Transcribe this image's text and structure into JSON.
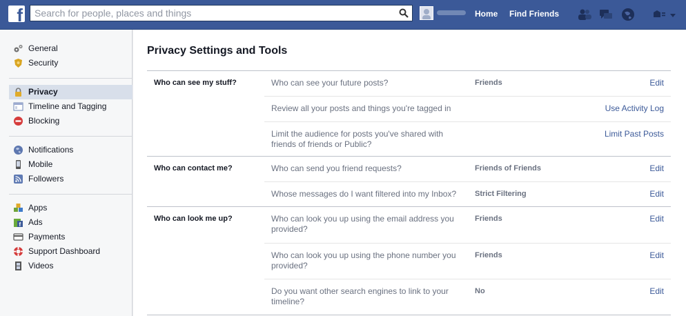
{
  "topbar": {
    "search_placeholder": "Search for people, places and things",
    "nav_home": "Home",
    "nav_find_friends": "Find Friends",
    "icons": [
      "friend-requests-icon",
      "messages-icon",
      "notifications-globe-icon",
      "privacy-shortcuts-icon"
    ]
  },
  "colors": {
    "brand": "#3b5998",
    "link": "#3b5998",
    "sidebar_active": "#d8dfea"
  },
  "sidebar": {
    "groups": [
      [
        {
          "label": "General",
          "icon": "gears-icon"
        },
        {
          "label": "Security",
          "icon": "shield-badge-icon"
        }
      ],
      [
        {
          "label": "Privacy",
          "icon": "lock-icon",
          "active": true
        },
        {
          "label": "Timeline and Tagging",
          "icon": "timeline-icon"
        },
        {
          "label": "Blocking",
          "icon": "blocking-icon"
        }
      ],
      [
        {
          "label": "Notifications",
          "icon": "globe-icon"
        },
        {
          "label": "Mobile",
          "icon": "mobile-phone-icon"
        },
        {
          "label": "Followers",
          "icon": "rss-icon"
        }
      ],
      [
        {
          "label": "Apps",
          "icon": "apps-cubes-icon"
        },
        {
          "label": "Ads",
          "icon": "ads-icon"
        },
        {
          "label": "Payments",
          "icon": "payments-icon"
        },
        {
          "label": "Support Dashboard",
          "icon": "lifebuoy-icon"
        },
        {
          "label": "Videos",
          "icon": "film-strip-icon"
        }
      ]
    ]
  },
  "main": {
    "title": "Privacy Settings and Tools",
    "sections": [
      {
        "title": "Who can see my stuff?",
        "rows": [
          {
            "question": "Who can see your future posts?",
            "value": "Friends",
            "action": "Edit"
          },
          {
            "question": "Review all your posts and things you're tagged in",
            "value": "",
            "action": "Use Activity Log"
          },
          {
            "question": "Limit the audience for posts you've shared with friends of friends or Public?",
            "value": "",
            "action": "Limit Past Posts"
          }
        ]
      },
      {
        "title": "Who can contact me?",
        "rows": [
          {
            "question": "Who can send you friend requests?",
            "value": "Friends of Friends",
            "action": "Edit"
          },
          {
            "question": "Whose messages do I want filtered into my Inbox?",
            "value": "Strict Filtering",
            "action": "Edit"
          }
        ]
      },
      {
        "title": "Who can look me up?",
        "rows": [
          {
            "question": "Who can look you up using the email address you provided?",
            "value": "Friends",
            "action": "Edit"
          },
          {
            "question": "Who can look you up using the phone number you provided?",
            "value": "Friends",
            "action": "Edit"
          },
          {
            "question": "Do you want other search engines to link to your timeline?",
            "value": "No",
            "action": "Edit"
          }
        ]
      }
    ]
  }
}
